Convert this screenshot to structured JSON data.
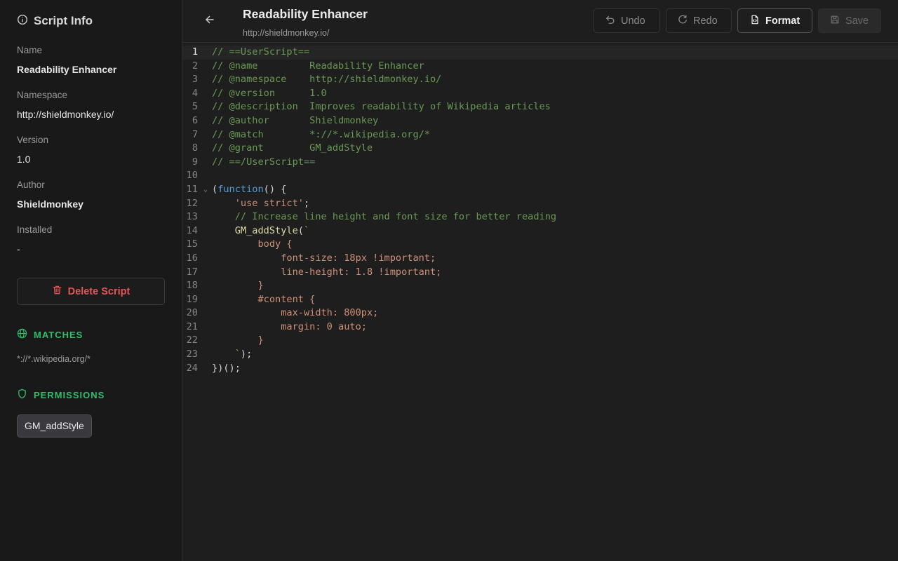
{
  "sidebar": {
    "title": "Script Info",
    "fields": [
      {
        "label": "Name",
        "value": "Readability Enhancer"
      },
      {
        "label": "Namespace",
        "value": "http://shieldmonkey.io/"
      },
      {
        "label": "Version",
        "value": "1.0"
      },
      {
        "label": "Author",
        "value": "Shieldmonkey"
      },
      {
        "label": "Installed",
        "value": "-"
      }
    ],
    "delete_label": "Delete Script",
    "matches_heading": "MATCHES",
    "matches": [
      "*://*.wikipedia.org/*"
    ],
    "permissions_heading": "PERMISSIONS",
    "permissions": [
      "GM_addStyle"
    ]
  },
  "header": {
    "title": "Readability Enhancer",
    "subtitle": "http://shieldmonkey.io/"
  },
  "toolbar": {
    "undo_label": "Undo",
    "redo_label": "Redo",
    "format_label": "Format",
    "save_label": "Save"
  },
  "editor": {
    "current_line": 1,
    "lines": [
      [
        [
          "c-com",
          "// ==UserScript=="
        ]
      ],
      [
        [
          "c-com",
          "// @name         Readability Enhancer"
        ]
      ],
      [
        [
          "c-com",
          "// @namespace    http://shieldmonkey.io/"
        ]
      ],
      [
        [
          "c-com",
          "// @version      1.0"
        ]
      ],
      [
        [
          "c-com",
          "// @description  Improves readability of Wikipedia articles"
        ]
      ],
      [
        [
          "c-com",
          "// @author       Shieldmonkey"
        ]
      ],
      [
        [
          "c-com",
          "// @match        *://*.wikipedia.org/*"
        ]
      ],
      [
        [
          "c-com",
          "// @grant        GM_addStyle"
        ]
      ],
      [
        [
          "c-com",
          "// ==/UserScript=="
        ]
      ],
      [],
      [
        [
          "c-p",
          "("
        ],
        [
          "c-kw",
          "function"
        ],
        [
          "c-p",
          "() {"
        ]
      ],
      [
        [
          "c-p",
          "    "
        ],
        [
          "c-str",
          "'use strict'"
        ],
        [
          "c-p",
          ";"
        ]
      ],
      [
        [
          "c-p",
          "    "
        ],
        [
          "c-com",
          "// Increase line height and font size for better reading"
        ]
      ],
      [
        [
          "c-p",
          "    "
        ],
        [
          "c-fn",
          "GM_addStyle"
        ],
        [
          "c-p",
          "("
        ],
        [
          "c-str",
          "`"
        ]
      ],
      [
        [
          "c-str",
          "        body {"
        ]
      ],
      [
        [
          "c-str",
          "            font-size: 18px !important;"
        ]
      ],
      [
        [
          "c-str",
          "            line-height: 1.8 !important;"
        ]
      ],
      [
        [
          "c-str",
          "        }"
        ]
      ],
      [
        [
          "c-str",
          "        #content {"
        ]
      ],
      [
        [
          "c-str",
          "            max-width: 800px;"
        ]
      ],
      [
        [
          "c-str",
          "            margin: 0 auto;"
        ]
      ],
      [
        [
          "c-str",
          "        }"
        ]
      ],
      [
        [
          "c-str",
          "    `"
        ],
        [
          "c-p",
          ");"
        ]
      ],
      [
        [
          "c-p",
          "})();"
        ]
      ]
    ],
    "fold_lines": [
      11
    ]
  }
}
